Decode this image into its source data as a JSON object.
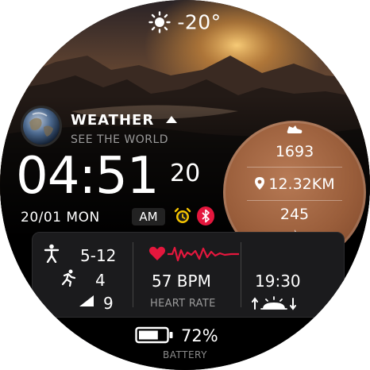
{
  "weather_top": {
    "temperature": "-20°",
    "icon": "sun-icon"
  },
  "weather": {
    "title": "WEATHER",
    "subtitle": "SEE THE WORLD",
    "arrow_icon": "triangle-up-icon",
    "globe_icon": "earth-globe-icon"
  },
  "clock": {
    "time": "04:51",
    "seconds": "20",
    "date": "20/01 MON",
    "ampm": "AM"
  },
  "status_icons": {
    "alarm": "alarm-icon",
    "bluetooth": "bluetooth-icon"
  },
  "activity": {
    "steps": "1693",
    "steps_icon": "shoe-icon",
    "distance": "12.32KM",
    "distance_icon": "location-pin-icon",
    "calories": "245",
    "calories_icon": "flame-icon"
  },
  "stats": {
    "floors": "5-12",
    "floors_icon": "person-icon",
    "run": "4",
    "run_icon": "running-icon",
    "signal": "9",
    "signal_icon": "signal-icon"
  },
  "heart": {
    "value": "57 BPM",
    "label": "HEART RATE",
    "icon": "heart-icon"
  },
  "sunrise": {
    "time": "19:30",
    "icon": "sunrise-sunset-icon"
  },
  "battery": {
    "value": "72%",
    "label": "BATTERY",
    "level": 0.72
  },
  "colors": {
    "accent_copper": "#9a5e3b",
    "heart_red": "#e4173d",
    "alarm_yellow": "#f5c400"
  }
}
